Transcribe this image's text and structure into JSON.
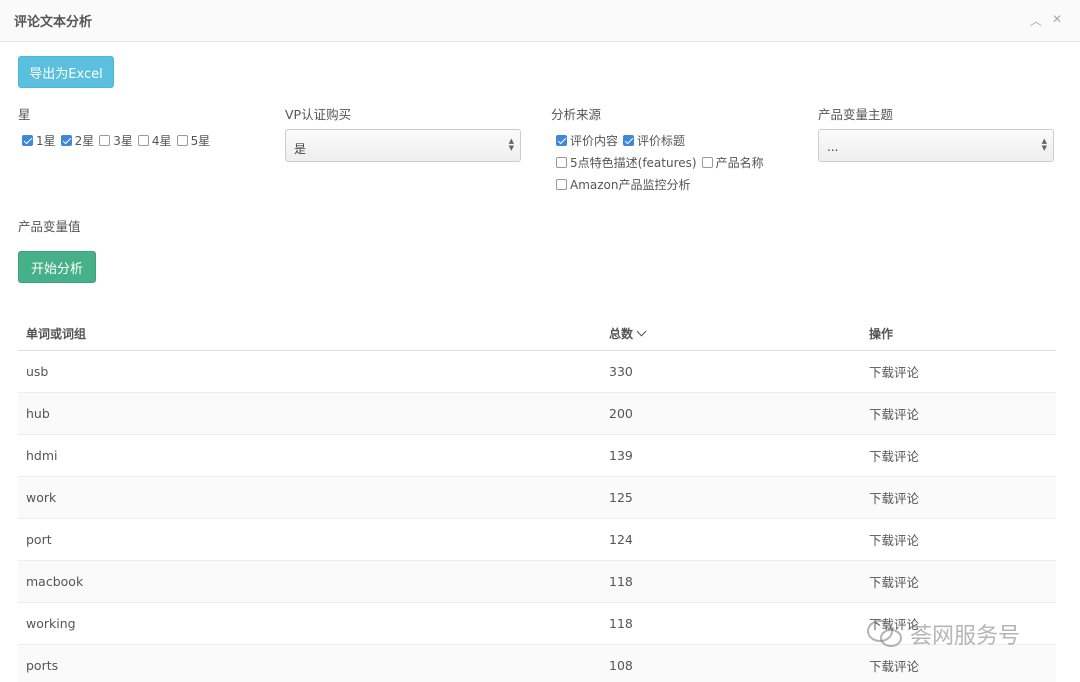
{
  "panel": {
    "title": "评论文本分析",
    "collapse_icon": "chevron-up-icon",
    "close_icon": "close-icon"
  },
  "buttons": {
    "export": "导出为Excel",
    "start": "开始分析"
  },
  "filters": {
    "star": {
      "label": "星",
      "options": [
        {
          "label": "1星",
          "checked": true
        },
        {
          "label": "2星",
          "checked": true
        },
        {
          "label": "3星",
          "checked": false
        },
        {
          "label": "4星",
          "checked": false
        },
        {
          "label": "5星",
          "checked": false
        }
      ]
    },
    "vp": {
      "label": "VP认证购买",
      "selected": "是"
    },
    "source": {
      "label": "分析来源",
      "options": [
        {
          "label": "评价内容",
          "checked": true
        },
        {
          "label": "评价标题",
          "checked": true
        },
        {
          "label": "5点特色描述(features)",
          "checked": false
        },
        {
          "label": "产品名称",
          "checked": false
        },
        {
          "label": "Amazon产品监控分析",
          "checked": false
        }
      ]
    },
    "theme": {
      "label": "产品变量主题",
      "selected": "..."
    },
    "variable_value": {
      "label": "产品变量值"
    }
  },
  "table": {
    "headers": [
      "单词或词组",
      "总数",
      "操作"
    ],
    "rows": [
      {
        "word": "usb",
        "count": "330",
        "action": "下载评论"
      },
      {
        "word": "hub",
        "count": "200",
        "action": "下载评论"
      },
      {
        "word": "hdmi",
        "count": "139",
        "action": "下载评论"
      },
      {
        "word": "work",
        "count": "125",
        "action": "下载评论"
      },
      {
        "word": "port",
        "count": "124",
        "action": "下载评论"
      },
      {
        "word": "macbook",
        "count": "118",
        "action": "下载评论"
      },
      {
        "word": "working",
        "count": "118",
        "action": "下载评论"
      },
      {
        "word": "ports",
        "count": "108",
        "action": "下载评论"
      }
    ]
  },
  "watermark": {
    "text": "荟网服务号"
  }
}
